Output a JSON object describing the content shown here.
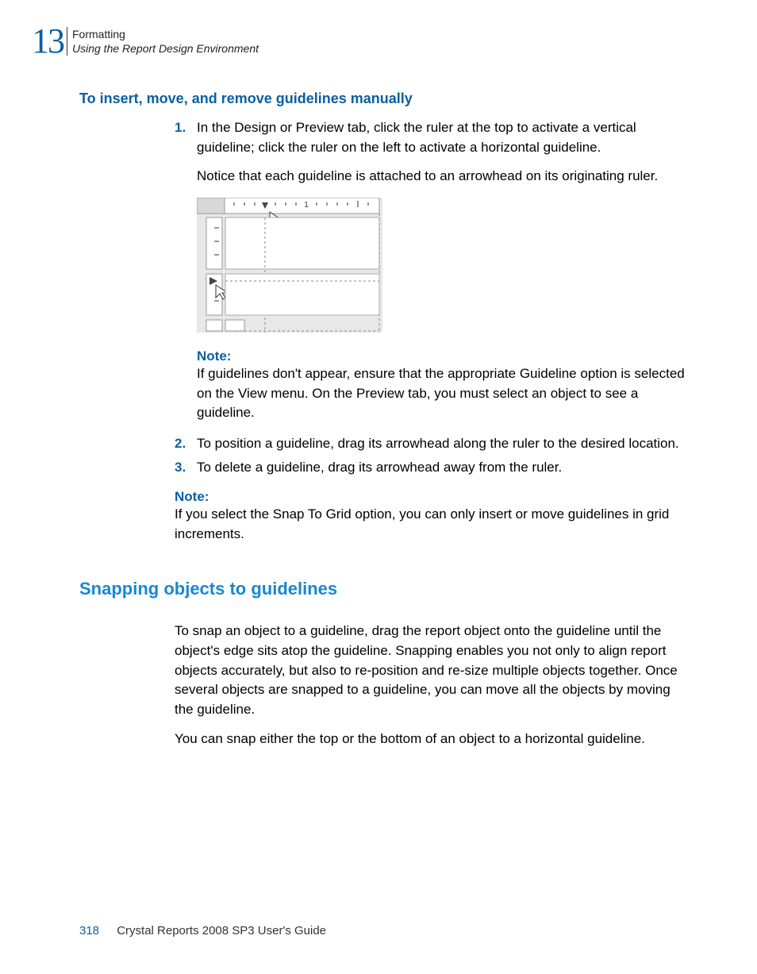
{
  "header": {
    "chapter_number": "13",
    "chapter_title": "Formatting",
    "section_title": "Using the Report Design Environment"
  },
  "section1": {
    "heading": "To insert, move, and remove guidelines manually",
    "step1_num": "1.",
    "step1_text": "In the Design or Preview tab, click the ruler at the top to activate a vertical guideline; click the ruler on the left to activate a horizontal guideline.",
    "step1_followup": "Notice that each guideline is attached to an arrowhead on its originating ruler.",
    "note1_label": "Note:",
    "note1_text": "If guidelines don't appear, ensure that the appropriate Guideline option is selected on the View menu. On the Preview tab, you must select an object to see a guideline.",
    "step2_num": "2.",
    "step2_text": "To position a guideline, drag its arrowhead along the ruler to the desired location.",
    "step3_num": "3.",
    "step3_text": "To delete a guideline, drag its arrowhead away from the ruler.",
    "note2_label": "Note:",
    "note2_text": "If you select the Snap To Grid option, you can only insert or move guidelines in grid increments."
  },
  "section2": {
    "heading": "Snapping objects to guidelines",
    "para1": "To snap an object to a guideline, drag the report object onto the guideline until the object's edge sits atop the guideline. Snapping enables you not only to align report objects accurately, but also to re-position and re-size multiple objects together. Once several objects are snapped to a guideline, you can move all the objects by moving the guideline.",
    "para2": "You can snap either the top or the bottom of an object to a horizontal guideline."
  },
  "footer": {
    "page_number": "318",
    "doc_title": "Crystal Reports 2008 SP3 User's Guide"
  }
}
